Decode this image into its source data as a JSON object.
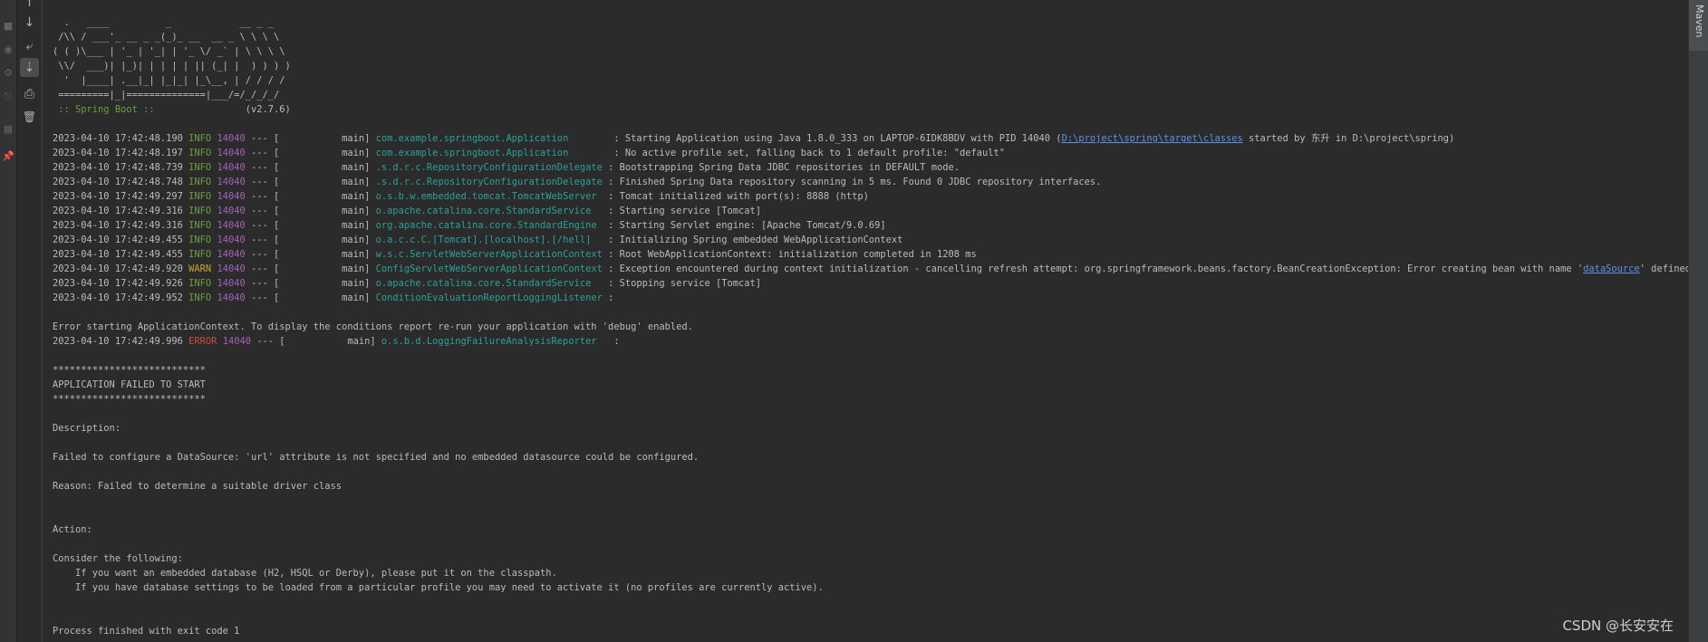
{
  "toolbar": {
    "buttons": [
      {
        "name": "rerun-icon",
        "glyph": "↑"
      },
      {
        "name": "scroll-down-icon",
        "glyph": "↓"
      },
      {
        "name": "soft-wrap-icon",
        "glyph": "⤶"
      },
      {
        "name": "scroll-to-end-icon",
        "glyph": "⇣"
      },
      {
        "name": "print-icon",
        "glyph": "⎙"
      },
      {
        "name": "clear-all-icon",
        "glyph": "🗑"
      }
    ]
  },
  "right_panel": {
    "maven_label": "Maven"
  },
  "banner": {
    "lines": [
      "  .   ____          _            __ _ _",
      " /\\\\ / ___'_ __ _ _(_)_ __  __ _ \\ \\ \\ \\",
      "( ( )\\___ | '_ | '_| | '_ \\/ _` | \\ \\ \\ \\",
      " \\\\/  ___)| |_)| | | | | || (_| |  ) ) ) )",
      "  '  |____| .__|_| |_|_| |_\\__, | / / / /",
      " =========|_|==============|___/=/_/_/_/"
    ],
    "spring_label": " :: Spring Boot ::",
    "spring_version": "                (v2.7.6)"
  },
  "logs": [
    {
      "ts": "2023-04-10 17:42:48.190",
      "level": "INFO",
      "pid": "14040",
      "sep": " --- [           main] ",
      "logger": "com.example.springboot.Application       ",
      "msg_pre": " : Starting Application using Java 1.8.0_333 on LAPTOP-6IDK8BDV with PID 14040 (",
      "link": "D:\\project\\spring\\target\\classes",
      "msg_post": " started by 东升 in D:\\project\\spring)"
    },
    {
      "ts": "2023-04-10 17:42:48.197",
      "level": "INFO",
      "pid": "14040",
      "sep": " --- [           main] ",
      "logger": "com.example.springboot.Application       ",
      "msg_pre": " : No active profile set, falling back to 1 default profile: \"default\"",
      "link": "",
      "msg_post": ""
    },
    {
      "ts": "2023-04-10 17:42:48.739",
      "level": "INFO",
      "pid": "14040",
      "sep": " --- [           main] ",
      "logger": ".s.d.r.c.RepositoryConfigurationDelegate",
      "msg_pre": " : Bootstrapping Spring Data JDBC repositories in DEFAULT mode.",
      "link": "",
      "msg_post": ""
    },
    {
      "ts": "2023-04-10 17:42:48.748",
      "level": "INFO",
      "pid": "14040",
      "sep": " --- [           main] ",
      "logger": ".s.d.r.c.RepositoryConfigurationDelegate",
      "msg_pre": " : Finished Spring Data repository scanning in 5 ms. Found 0 JDBC repository interfaces.",
      "link": "",
      "msg_post": ""
    },
    {
      "ts": "2023-04-10 17:42:49.297",
      "level": "INFO",
      "pid": "14040",
      "sep": " --- [           main] ",
      "logger": "o.s.b.w.embedded.tomcat.TomcatWebServer ",
      "msg_pre": " : Tomcat initialized with port(s): 8888 (http)",
      "link": "",
      "msg_post": ""
    },
    {
      "ts": "2023-04-10 17:42:49.316",
      "level": "INFO",
      "pid": "14040",
      "sep": " --- [           main] ",
      "logger": "o.apache.catalina.core.StandardService  ",
      "msg_pre": " : Starting service [Tomcat]",
      "link": "",
      "msg_post": ""
    },
    {
      "ts": "2023-04-10 17:42:49.316",
      "level": "INFO",
      "pid": "14040",
      "sep": " --- [           main] ",
      "logger": "org.apache.catalina.core.StandardEngine ",
      "msg_pre": " : Starting Servlet engine: [Apache Tomcat/9.0.69]",
      "link": "",
      "msg_post": ""
    },
    {
      "ts": "2023-04-10 17:42:49.455",
      "level": "INFO",
      "pid": "14040",
      "sep": " --- [           main] ",
      "logger": "o.a.c.c.C.[Tomcat].[localhost].[/hell]  ",
      "msg_pre": " : Initializing Spring embedded WebApplicationContext",
      "link": "",
      "msg_post": ""
    },
    {
      "ts": "2023-04-10 17:42:49.455",
      "level": "INFO",
      "pid": "14040",
      "sep": " --- [           main] ",
      "logger": "w.s.c.ServletWebServerApplicationContext",
      "msg_pre": " : Root WebApplicationContext: initialization completed in 1208 ms",
      "link": "",
      "msg_post": ""
    },
    {
      "ts": "2023-04-10 17:42:49.920",
      "level": "WARN",
      "pid": "14040",
      "sep": " --- [           main] ",
      "logger": "ConfigServletWebServerApplicationContext",
      "msg_pre": " : Exception encountered during context initialization - cancelling refresh attempt: org.springframework.beans.factory.BeanCreationException: Error creating bean with name '",
      "link": "dataSource",
      "msg_post": "' defined in class pa"
    },
    {
      "ts": "2023-04-10 17:42:49.926",
      "level": "INFO",
      "pid": "14040",
      "sep": " --- [           main] ",
      "logger": "o.apache.catalina.core.StandardService  ",
      "msg_pre": " : Stopping service [Tomcat]",
      "link": "",
      "msg_post": ""
    },
    {
      "ts": "2023-04-10 17:42:49.952",
      "level": "INFO",
      "pid": "14040",
      "sep": " --- [           main] ",
      "logger": "ConditionEvaluationReportLoggingListener",
      "msg_pre": " :",
      "link": "",
      "msg_post": ""
    }
  ],
  "error_hint": "Error starting ApplicationContext. To display the conditions report re-run your application with 'debug' enabled.",
  "error_log": {
    "ts": "2023-04-10 17:42:49.996",
    "level": "ERROR",
    "pid": "14040",
    "sep": " --- [           main] ",
    "logger": "o.s.b.d.LoggingFailureAnalysisReporter  ",
    "msg_pre": " :",
    "link": "",
    "msg_post": ""
  },
  "failure": {
    "stars": "***************************",
    "title": "APPLICATION FAILED TO START",
    "description_label": "Description:",
    "description": "Failed to configure a DataSource: 'url' attribute is not specified and no embedded datasource could be configured.",
    "reason": "Reason: Failed to determine a suitable driver class",
    "action_label": "Action:",
    "consider": "Consider the following:",
    "action_1": "    If you want an embedded database (H2, HSQL or Derby), please put it on the classpath.",
    "action_2": "    If you have database settings to be loaded from a particular profile you may need to activate it (no profiles are currently active).",
    "exit": "Process finished with exit code 1"
  },
  "watermark": "CSDN @长安安在"
}
